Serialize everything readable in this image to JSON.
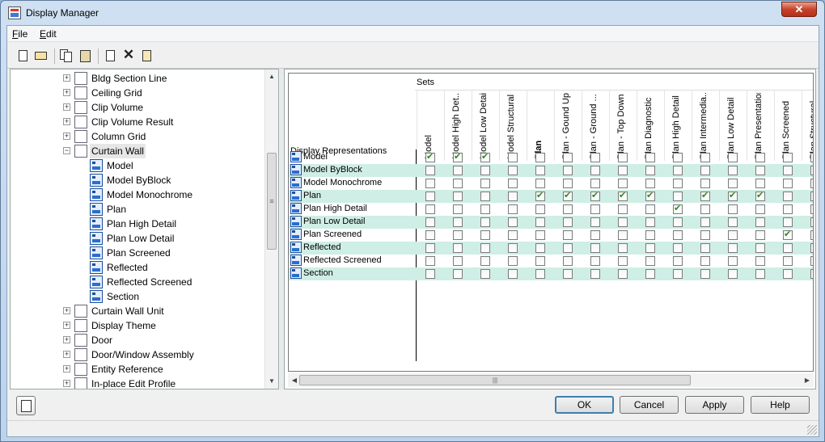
{
  "window": {
    "title": "Display Manager",
    "close_glyph": "✕"
  },
  "menu": [
    {
      "key": "F",
      "rest": "ile"
    },
    {
      "key": "E",
      "rest": "dit"
    }
  ],
  "toolbar": [
    {
      "icon": "new-document-icon"
    },
    {
      "icon": "open-folder-icon"
    },
    {
      "icon": "copy-icon"
    },
    {
      "icon": "paste-icon"
    },
    {
      "icon": "purge-icon"
    },
    {
      "icon": "delete-icon"
    },
    {
      "icon": "rename-icon"
    }
  ],
  "tree": {
    "items": [
      {
        "label": "Bldg Section Line",
        "level": 0,
        "expander": "+"
      },
      {
        "label": "Ceiling Grid",
        "level": 0,
        "expander": "+"
      },
      {
        "label": "Clip Volume",
        "level": 0,
        "expander": "+"
      },
      {
        "label": "Clip Volume Result",
        "level": 0,
        "expander": "+"
      },
      {
        "label": "Column Grid",
        "level": 0,
        "expander": "+"
      },
      {
        "label": "Curtain Wall",
        "level": 0,
        "expander": "−",
        "selected": true
      },
      {
        "label": "Model",
        "level": 1
      },
      {
        "label": "Model ByBlock",
        "level": 1
      },
      {
        "label": "Model Monochrome",
        "level": 1
      },
      {
        "label": "Plan",
        "level": 1
      },
      {
        "label": "Plan High Detail",
        "level": 1
      },
      {
        "label": "Plan Low Detail",
        "level": 1
      },
      {
        "label": "Plan Screened",
        "level": 1
      },
      {
        "label": "Reflected",
        "level": 1
      },
      {
        "label": "Reflected Screened",
        "level": 1
      },
      {
        "label": "Section",
        "level": 1
      },
      {
        "label": "Curtain Wall Unit",
        "level": 0,
        "expander": "+"
      },
      {
        "label": "Display Theme",
        "level": 0,
        "expander": "+"
      },
      {
        "label": "Door",
        "level": 0,
        "expander": "+"
      },
      {
        "label": "Door/Window Assembly",
        "level": 0,
        "expander": "+"
      },
      {
        "label": "Entity Reference",
        "level": 0,
        "expander": "+"
      },
      {
        "label": "In-place Edit Profile",
        "level": 0,
        "expander": "+"
      }
    ],
    "scroll_up": "▲",
    "scroll_down": "▼",
    "scroll_grip": "≡"
  },
  "grid": {
    "sets_label": "Sets",
    "rep_header": "Display Representations",
    "columns": [
      {
        "label": "Model"
      },
      {
        "label": "Model High Det..."
      },
      {
        "label": "Model Low Detail"
      },
      {
        "label": "Model Structural"
      },
      {
        "label": "Plan",
        "bold": true
      },
      {
        "label": "Plan - Gound Up"
      },
      {
        "label": "Plan - Ground ..."
      },
      {
        "label": "Plan - Top Down"
      },
      {
        "label": "Plan Diagnostic"
      },
      {
        "label": "Plan High Detail"
      },
      {
        "label": "Plan Intermedia..."
      },
      {
        "label": "Plan Low Detail"
      },
      {
        "label": "Plan Presentation"
      },
      {
        "label": "Plan Screened"
      },
      {
        "label": "Plan Structural"
      }
    ],
    "rows": [
      {
        "label": "Model",
        "checked": [
          0,
          1,
          2
        ]
      },
      {
        "label": "Model ByBlock",
        "checked": []
      },
      {
        "label": "Model Monochrome",
        "checked": []
      },
      {
        "label": "Plan",
        "checked": [
          4,
          5,
          6,
          7,
          8,
          10,
          11,
          12
        ]
      },
      {
        "label": "Plan High Detail",
        "checked": [
          9
        ]
      },
      {
        "label": "Plan Low Detail",
        "checked": []
      },
      {
        "label": "Plan Screened",
        "checked": [
          13
        ]
      },
      {
        "label": "Reflected",
        "checked": []
      },
      {
        "label": "Reflected Screened",
        "checked": []
      },
      {
        "label": "Section",
        "checked": []
      }
    ],
    "hscroll_left": "◀",
    "hscroll_right": "▶",
    "hscroll_grip": "|||"
  },
  "buttons": {
    "ok": "OK",
    "cancel": "Cancel",
    "apply": "Apply",
    "help": "Help"
  },
  "colors": {
    "alt_row": "#cfeee5",
    "check": "#2e8a23",
    "default_button_border": "#3c7fb1"
  }
}
